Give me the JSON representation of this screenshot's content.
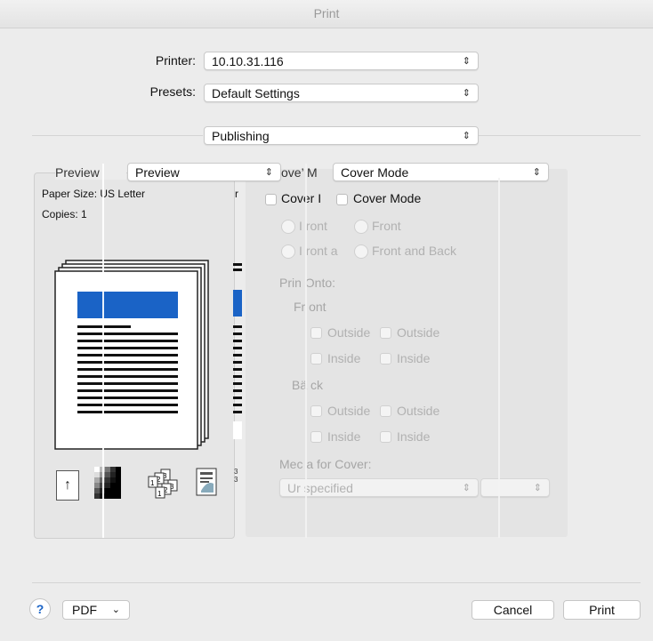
{
  "window": {
    "title": "Print"
  },
  "printer": {
    "label": "Printer:",
    "value": "10.10.31.116"
  },
  "presets": {
    "label": "Presets:",
    "value": "Default Settings"
  },
  "section": {
    "value": "Publishing"
  },
  "preview_popup": {
    "label_fragment": "Previеw",
    "value": "Preview"
  },
  "cover_popup": {
    "label_fragment": "ove’ M",
    "value": "Cover Mode"
  },
  "paper": {
    "size_text": "Paper Sizе: US Letter",
    "copies_text": "Copies: 1",
    "extra_char": "r"
  },
  "cover_mode": {
    "checkbox_fragment": "Covеr I",
    "checkbox_label": "Cover Mode",
    "front_fragment": "I ront",
    "front_label": "Front",
    "front_back_fragment": "I ront а",
    "front_back_label": "Front and Back",
    "print_onto": "Prin Onto:",
    "front_heading": "Fr ont",
    "outside_fragment": "Outsidе",
    "outside_label": "Outside",
    "inside_label": "Inside",
    "back_heading": "Bä ck",
    "media_label": "Meс a for Cover:",
    "media_value": "Ur specified"
  },
  "footer": {
    "help": "?",
    "pdf": "PDF",
    "cancel": "Cancel",
    "print": "Print"
  },
  "colors": {
    "accent_blue": "#1a63c6",
    "background": "#ececec"
  }
}
